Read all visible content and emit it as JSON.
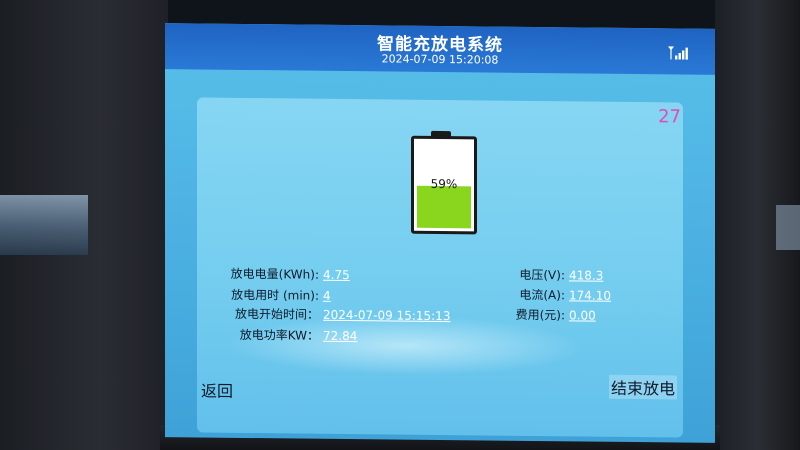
{
  "header": {
    "title": "智能充放电系统",
    "datetime": "2024-07-09 15:20:08"
  },
  "counter": "27",
  "battery": {
    "percent_text": "59%",
    "level": 59,
    "fill_color": "#8ad61f"
  },
  "left_fields": [
    {
      "label": "放电电量(KWh):",
      "value": "4.75"
    },
    {
      "label": "放电用时 (min):",
      "value": "4"
    },
    {
      "label": "放电开始时间：",
      "value": "2024-07-09 15:15:13"
    },
    {
      "label": "放电功率KW：",
      "value": "72.84"
    }
  ],
  "right_fields": [
    {
      "label": "电压(V):",
      "value": "418.3"
    },
    {
      "label": "电流(A):",
      "value": "174.10"
    },
    {
      "label": "费用(元):",
      "value": "0.00"
    }
  ],
  "buttons": {
    "back": "返回",
    "end": "结束放电"
  },
  "colors": {
    "header": "#1f63c2",
    "panel": "#7ad0f0",
    "counter": "#e24ab6"
  },
  "icons": {
    "signal": "signal-strength-icon"
  }
}
